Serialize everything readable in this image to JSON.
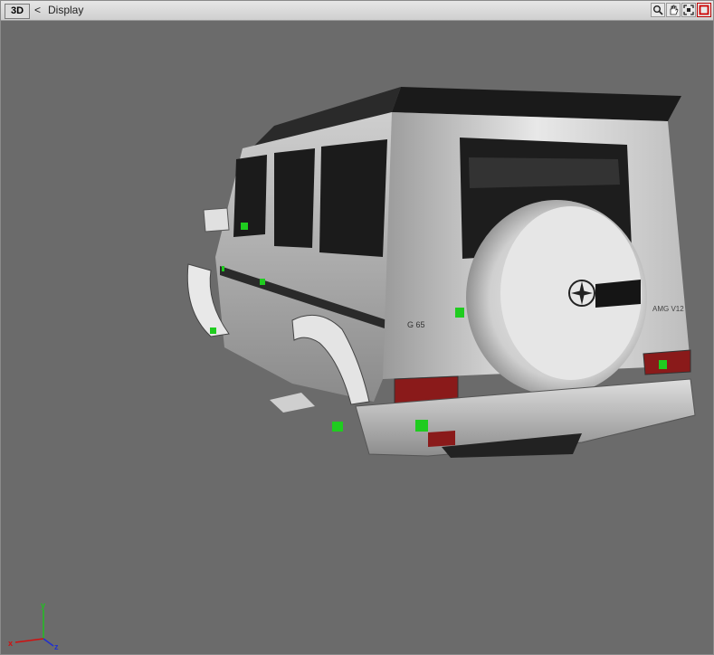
{
  "titlebar": {
    "mode_badge": "3D",
    "back_chevron": "<",
    "view_title": "Display"
  },
  "toolbar": {
    "tools": [
      {
        "name": "zoom-icon"
      },
      {
        "name": "pan-hand-icon"
      },
      {
        "name": "fit-view-icon"
      },
      {
        "name": "maximize-icon"
      }
    ]
  },
  "model": {
    "rear_badge": "G 65",
    "tailgate_badge": "AMG V12",
    "paint_color": "#d8d8d8",
    "marker_color": "#1fcc1f",
    "taillight_color": "#8a1a1a"
  },
  "axes": {
    "x": "x",
    "y": "y",
    "z": "z",
    "x_color": "#d01010",
    "y_color": "#20c020",
    "z_color": "#2030d0"
  }
}
